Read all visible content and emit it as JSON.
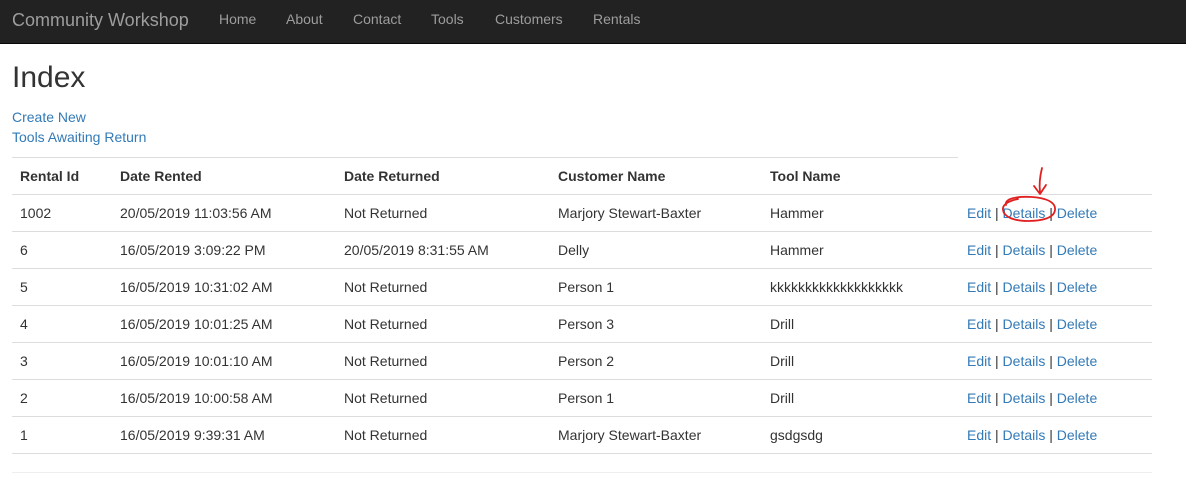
{
  "navbar": {
    "brand": "Community Workshop",
    "links": [
      {
        "label": "Home"
      },
      {
        "label": "About"
      },
      {
        "label": "Contact"
      },
      {
        "label": "Tools"
      },
      {
        "label": "Customers"
      },
      {
        "label": "Rentals"
      }
    ],
    "background_color": "#222222",
    "text_color": "#9d9d9d"
  },
  "page": {
    "title": "Index",
    "create_new_label": "Create New",
    "awaiting_return_label": "Tools Awaiting Return",
    "link_color": "#337ab7"
  },
  "table": {
    "headers": [
      "Rental Id",
      "Date Rented",
      "Date Returned",
      "Customer Name",
      "Tool Name"
    ],
    "action_labels": {
      "edit": "Edit",
      "details": "Details",
      "delete": "Delete",
      "separator": "|"
    },
    "rows": [
      {
        "id": "1002",
        "date_rented": "20/05/2019 11:03:56 AM",
        "date_returned": "Not Returned",
        "customer": "Marjory Stewart-Baxter",
        "tool": "Hammer"
      },
      {
        "id": "6",
        "date_rented": "16/05/2019 3:09:22 PM",
        "date_returned": "20/05/2019 8:31:55 AM",
        "customer": "Delly",
        "tool": "Hammer"
      },
      {
        "id": "5",
        "date_rented": "16/05/2019 10:31:02 AM",
        "date_returned": "Not Returned",
        "customer": "Person 1",
        "tool": "kkkkkkkkkkkkkkkkkkk"
      },
      {
        "id": "4",
        "date_rented": "16/05/2019 10:01:25 AM",
        "date_returned": "Not Returned",
        "customer": "Person 3",
        "tool": "Drill"
      },
      {
        "id": "3",
        "date_rented": "16/05/2019 10:01:10 AM",
        "date_returned": "Not Returned",
        "customer": "Person 2",
        "tool": "Drill"
      },
      {
        "id": "2",
        "date_rented": "16/05/2019 10:00:58 AM",
        "date_returned": "Not Returned",
        "customer": "Person 1",
        "tool": "Drill"
      },
      {
        "id": "1",
        "date_rented": "16/05/2019 9:39:31 AM",
        "date_returned": "Not Returned",
        "customer": "Marjory Stewart-Baxter",
        "tool": "gsdgsdg"
      }
    ]
  },
  "annotation": {
    "color": "#e02020"
  }
}
